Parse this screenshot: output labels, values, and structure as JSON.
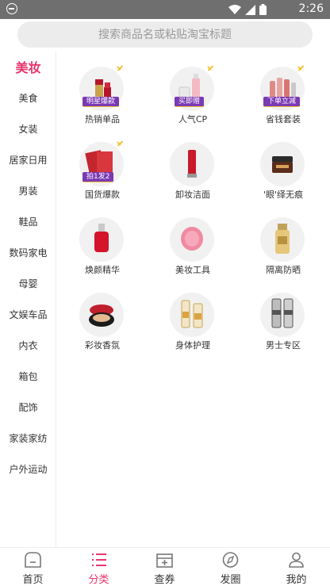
{
  "status_bar": {
    "time": "2:26"
  },
  "search": {
    "placeholder": "搜索商品名或粘贴淘宝标题"
  },
  "sidebar": {
    "items": [
      {
        "label": "美妆",
        "active": true
      },
      {
        "label": "美食"
      },
      {
        "label": "女装"
      },
      {
        "label": "居家日用"
      },
      {
        "label": "男装"
      },
      {
        "label": "鞋品"
      },
      {
        "label": "数码家电"
      },
      {
        "label": "母婴"
      },
      {
        "label": "文娱车品"
      },
      {
        "label": "内衣"
      },
      {
        "label": "箱包"
      },
      {
        "label": "配饰"
      },
      {
        "label": "家装家纺"
      },
      {
        "label": "户外运动"
      }
    ]
  },
  "grid": {
    "items": [
      {
        "label": "热销单品",
        "tag": "明星爆款",
        "icon": "lipstick-product-icon"
      },
      {
        "label": "人气CP",
        "tag": "买即赠",
        "icon": "skincare-set-product-icon"
      },
      {
        "label": "省钱套装",
        "tag": "下单立减",
        "icon": "bottle-set-product-icon"
      },
      {
        "label": "国货爆款",
        "tag": "拍1发2",
        "icon": "face-mask-product-icon"
      },
      {
        "label": "卸妆洁面",
        "tag": "",
        "icon": "cleanser-tube-product-icon"
      },
      {
        "label": "'眼'绎无痕",
        "tag": "",
        "icon": "eye-cream-jar-product-icon"
      },
      {
        "label": "焕颜精华",
        "tag": "",
        "icon": "serum-bottle-product-icon"
      },
      {
        "label": "美妆工具",
        "tag": "",
        "icon": "cleansing-brush-product-icon"
      },
      {
        "label": "隔离防晒",
        "tag": "",
        "icon": "sunscreen-bottle-product-icon"
      },
      {
        "label": "彩妆香氛",
        "tag": "",
        "icon": "cushion-compact-product-icon"
      },
      {
        "label": "身体护理",
        "tag": "",
        "icon": "body-oil-bottles-product-icon"
      },
      {
        "label": "男士专区",
        "tag": "",
        "icon": "mens-bottles-product-icon"
      }
    ]
  },
  "tabbar": {
    "tabs": [
      {
        "label": "首页",
        "icon": "home-icon"
      },
      {
        "label": "分类",
        "icon": "category-list-icon",
        "active": true
      },
      {
        "label": "查券",
        "icon": "coupon-icon"
      },
      {
        "label": "发圈",
        "icon": "compass-icon"
      },
      {
        "label": "我的",
        "icon": "profile-icon"
      }
    ]
  },
  "colors": {
    "accent": "#e8356d",
    "tag_purple": "#7b3ab4",
    "tag_gold": "#f3c23a",
    "status_bar": "#6f6f6f"
  }
}
